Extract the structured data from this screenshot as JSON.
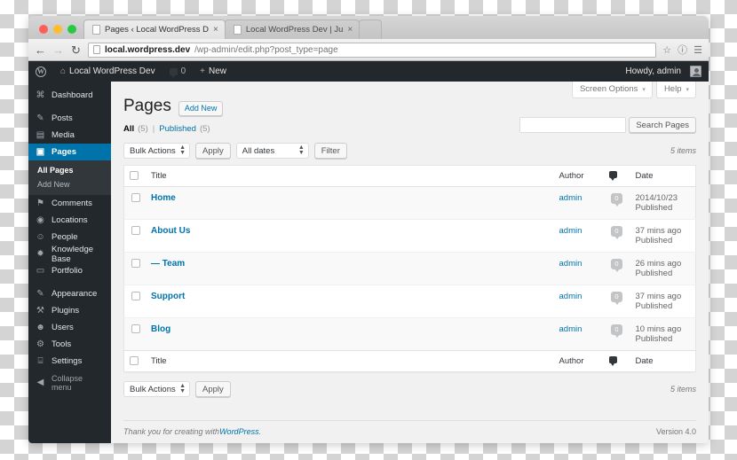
{
  "browser": {
    "tabs": [
      {
        "title": "Pages ‹ Local WordPress D",
        "close": "×",
        "active": true
      },
      {
        "title": "Local WordPress Dev | Ju",
        "close": "×",
        "active": false
      }
    ],
    "nav": {
      "back": "←",
      "forward": "→",
      "reload": "↻"
    },
    "url": {
      "host": "local.wordpress.dev",
      "path": "/wp-admin/edit.php?post_type=page"
    },
    "toolbar_icons": {
      "bookmark": "☆",
      "info": "ⓘ",
      "menu": "☰"
    }
  },
  "adminbar": {
    "wp_logo": "W",
    "site_icon": "⌂",
    "site_name": "Local WordPress Dev",
    "comments_icon": "💬",
    "comments_count": "0",
    "new_plus": "+",
    "new_label": "New",
    "howdy": "Howdy, admin"
  },
  "sidebar": {
    "items": [
      {
        "icon": "⌘",
        "label": "Dashboard",
        "current": false
      },
      {
        "icon": "✎",
        "label": "Posts",
        "current": false
      },
      {
        "icon": "▤",
        "label": "Media",
        "current": false
      },
      {
        "icon": "▣",
        "label": "Pages",
        "current": true
      },
      {
        "icon": "⚑",
        "label": "Comments",
        "current": false
      },
      {
        "icon": "◉",
        "label": "Locations",
        "current": false
      },
      {
        "icon": "☺",
        "label": "People",
        "current": false
      },
      {
        "icon": "✹",
        "label": "Knowledge Base",
        "current": false
      },
      {
        "icon": "▭",
        "label": "Portfolio",
        "current": false
      },
      {
        "icon": "✎",
        "label": "Appearance",
        "current": false
      },
      {
        "icon": "⚒",
        "label": "Plugins",
        "current": false
      },
      {
        "icon": "☻",
        "label": "Users",
        "current": false
      },
      {
        "icon": "⚙",
        "label": "Tools",
        "current": false
      },
      {
        "icon": "⌸",
        "label": "Settings",
        "current": false
      }
    ],
    "submenu": [
      {
        "label": "All Pages",
        "current": true
      },
      {
        "label": "Add New",
        "current": false
      }
    ],
    "collapse": {
      "icon": "◀",
      "label": "Collapse menu"
    }
  },
  "screen_meta": {
    "screen_options": "Screen Options",
    "help": "Help",
    "caret": "▾"
  },
  "page": {
    "title": "Pages",
    "add_new": "Add New"
  },
  "views": {
    "all_label": "All",
    "all_count": "(5)",
    "divider": "|",
    "published_label": "Published",
    "published_count": "(5)"
  },
  "search": {
    "value": "",
    "placeholder": "",
    "button": "Search Pages"
  },
  "tablenav_top": {
    "bulk_actions": "Bulk Actions",
    "apply": "Apply",
    "all_dates": "All dates",
    "filter": "Filter",
    "items": "5 items"
  },
  "tablenav_bottom": {
    "bulk_actions": "Bulk Actions",
    "apply": "Apply",
    "items": "5 items"
  },
  "table": {
    "columns": {
      "title": "Title",
      "author": "Author",
      "comments_icon": "comment-icon",
      "date": "Date"
    },
    "rows": [
      {
        "title": "Home",
        "author": "admin",
        "comments": "0",
        "date": "2014/10/23",
        "status": "Published"
      },
      {
        "title": "About Us",
        "author": "admin",
        "comments": "0",
        "date": "37 mins ago",
        "status": "Published"
      },
      {
        "title": "— Team",
        "author": "admin",
        "comments": "0",
        "date": "26 mins ago",
        "status": "Published"
      },
      {
        "title": "Support",
        "author": "admin",
        "comments": "0",
        "date": "37 mins ago",
        "status": "Published"
      },
      {
        "title": "Blog",
        "author": "admin",
        "comments": "0",
        "date": "10 mins ago",
        "status": "Published"
      }
    ]
  },
  "footer": {
    "thanks_prefix": "Thank you for creating with ",
    "wordpress_link": "WordPress",
    "thanks_suffix": ".",
    "version": "Version 4.0"
  },
  "colors": {
    "wp_blue": "#0073aa",
    "admin_dark": "#23282d",
    "submenu_dark": "#32373c",
    "link_blue": "#0073aa"
  }
}
